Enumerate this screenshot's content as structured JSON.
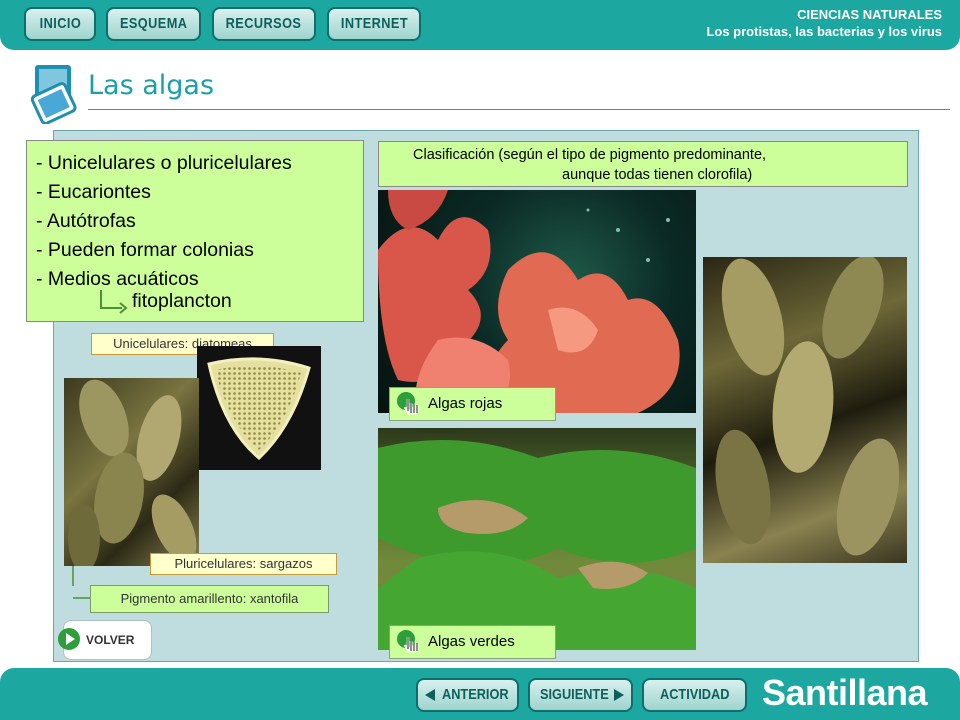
{
  "nav": {
    "inicio": "INICIO",
    "esquema": "ESQUEMA",
    "recursos": "RECURSOS",
    "internet": "INTERNET"
  },
  "course": {
    "subject": "CIENCIAS NATURALES",
    "unit": "Los protistas, las bacterias y los virus"
  },
  "page_title": "Las algas",
  "properties": [
    "- Unicelulares o pluricelulares",
    "- Eucariontes",
    "- Autótrofas",
    "- Pueden formar colonias",
    "- Medios acuáticos"
  ],
  "fitoplancton": "fitoplancton",
  "classification": {
    "line1": "Clasificación (según el tipo de pigmento predominante,",
    "line2": "aunque todas tienen clorofila)"
  },
  "tags": {
    "unicelulares": "Unicelulares: diatomeas",
    "pluricelulares": "Pluricelulares: sargazos",
    "pigmento": "Pigmento amarillento: xantofila"
  },
  "algae_buttons": {
    "rojas": "Algas rojas",
    "verdes": "Algas verdes"
  },
  "volver": "VOLVER",
  "footer": {
    "anterior": "ANTERIOR",
    "siguiente": "SIGUIENTE",
    "actividad": "ACTIVIDAD",
    "brand": "Santillana"
  },
  "colors": {
    "bar": "#1ca8a0",
    "title": "#1aa0a8",
    "panel": "#bfdcdf",
    "green_box": "#ccff99",
    "tag": "#ffffcc"
  }
}
